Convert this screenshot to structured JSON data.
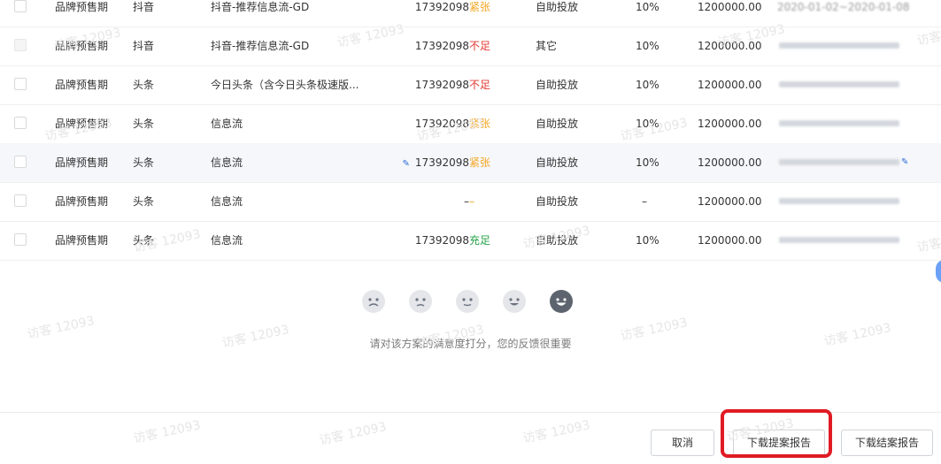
{
  "watermark": "访客 12093",
  "table": {
    "rows": [
      {
        "type": "品牌预售期",
        "media": "抖音",
        "channel": "抖音-推荐信息流-GD",
        "id": "17392098",
        "status": "紧张",
        "status_kind": "tight",
        "mode": "自助投放",
        "ratio": "10%",
        "amount": "1200000.00",
        "date": "2020-01-02~2020-01-08",
        "disabled": false,
        "highlight": false,
        "edit": false
      },
      {
        "type": "品牌预售期",
        "media": "抖音",
        "channel": "抖音-推荐信息流-GD",
        "id": "17392098",
        "status": "不足",
        "status_kind": "short",
        "mode": "其它",
        "ratio": "10%",
        "amount": "1200000.00",
        "date": "",
        "disabled": true,
        "highlight": false,
        "edit": false
      },
      {
        "type": "品牌预售期",
        "media": "头条",
        "channel": "今日头条（含今日头条极速版...",
        "id": "17392098",
        "status": "不足",
        "status_kind": "short",
        "mode": "自助投放",
        "ratio": "10%",
        "amount": "1200000.00",
        "date": "",
        "disabled": false,
        "highlight": false,
        "edit": false
      },
      {
        "type": "品牌预售期",
        "media": "头条",
        "channel": "信息流",
        "id": "17392098",
        "status": "紧张",
        "status_kind": "tight",
        "mode": "自助投放",
        "ratio": "10%",
        "amount": "1200000.00",
        "date": "",
        "disabled": false,
        "highlight": false,
        "edit": false
      },
      {
        "type": "品牌预售期",
        "media": "头条",
        "channel": "信息流",
        "id": "17392098",
        "status": "紧张",
        "status_kind": "tight",
        "mode": "自助投放",
        "ratio": "10%",
        "amount": "1200000.00",
        "date": "",
        "disabled": false,
        "highlight": true,
        "edit": true
      },
      {
        "type": "品牌预售期",
        "media": "头条",
        "channel": "信息流",
        "id": "–",
        "status": "–",
        "status_kind": "none",
        "mode": "自助投放",
        "ratio": "–",
        "amount": "1200000.00",
        "date": "",
        "disabled": false,
        "highlight": false,
        "edit": false
      },
      {
        "type": "品牌预售期",
        "media": "头条",
        "channel": "信息流",
        "id": "17392098",
        "status": "充足",
        "status_kind": "full",
        "mode": "自助投放",
        "ratio": "10%",
        "amount": "1200000.00",
        "date": "",
        "disabled": false,
        "highlight": false,
        "edit": false
      }
    ]
  },
  "rating": {
    "prompt": "请对该方案的满意度打分，您的反馈很重要",
    "faces": [
      "very-unsatisfied-face-icon",
      "unsatisfied-face-icon",
      "neutral-face-icon",
      "satisfied-face-icon",
      "very-satisfied-face-icon"
    ]
  },
  "footer": {
    "cancel_label": "取消",
    "download_proposal_label": "下载提案报告",
    "download_final_label": "下载结案报告"
  },
  "colors": {
    "accent": "#2f6bd8",
    "tight": "#f5a623",
    "short": "#e53935",
    "full": "#27a34a",
    "highlight_border": "#e01b24"
  }
}
